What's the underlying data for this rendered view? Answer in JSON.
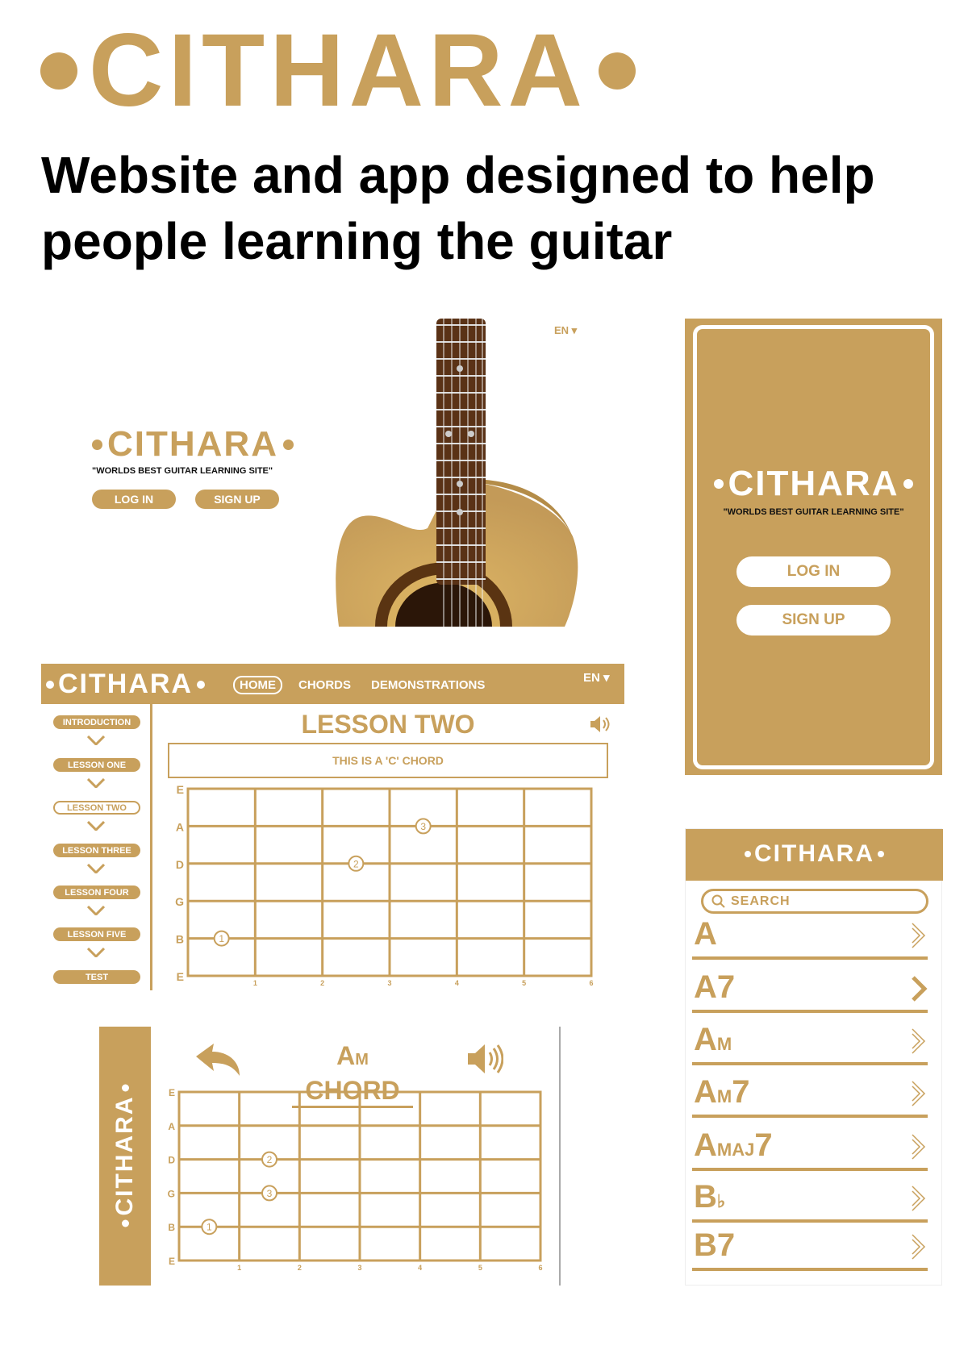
{
  "brand": "CITHARA",
  "headline": "Website and app designed to help people learning the guitar",
  "colors": {
    "gold": "#C8A05C",
    "dark": "#4a2a12"
  },
  "hero": {
    "tagline": "\"WORLDS BEST GUITAR LEARNING SITE\"",
    "login": "LOG IN",
    "signup": "SIGN UP",
    "lang": "EN"
  },
  "phone_login": {
    "tagline": "\"WORLDS BEST GUITAR LEARNING SITE\"",
    "login": "LOG IN",
    "signup": "SIGN UP"
  },
  "lesson": {
    "nav": {
      "home": "HOME",
      "chords": "CHORDS",
      "demos": "DEMONSTRATIONS",
      "lang": "EN"
    },
    "sidebar": [
      "INTRODUCTION",
      "LESSON ONE",
      "LESSON TWO",
      "LESSON THREE",
      "LESSON FOUR",
      "LESSON FIVE",
      "TEST"
    ],
    "active_index": 2,
    "title": "LESSON TWO",
    "caption": "THIS IS A 'C' CHORD"
  },
  "chord_view": {
    "title_main": "A",
    "title_sub": "M",
    "title_rest": " CHORD"
  },
  "chord_data": [
    {
      "type": "fretboard",
      "strings": [
        "E",
        "A",
        "D",
        "G",
        "B",
        "E"
      ],
      "frets": [
        "1",
        "2",
        "3",
        "4",
        "5",
        "6"
      ],
      "fingers": [
        {
          "label": "3",
          "string": 1,
          "cell": 4
        },
        {
          "label": "2",
          "string": 2,
          "cell": 3
        },
        {
          "label": "1",
          "string": 4,
          "cell": 1
        }
      ]
    },
    {
      "type": "fretboard",
      "strings": [
        "E",
        "A",
        "D",
        "G",
        "B",
        "E"
      ],
      "frets": [
        "1",
        "2",
        "3",
        "4",
        "5",
        "6"
      ],
      "fingers": [
        {
          "label": "2",
          "string": 2,
          "cell": 2
        },
        {
          "label": "3",
          "string": 3,
          "cell": 2
        },
        {
          "label": "1",
          "string": 4,
          "cell": 1
        }
      ]
    }
  ],
  "chord_list": {
    "search_placeholder": "SEARCH",
    "items": [
      {
        "main": "A",
        "sub": "",
        "tail": ""
      },
      {
        "main": "A7",
        "sub": "",
        "tail": ""
      },
      {
        "main": "A",
        "sub": "M",
        "tail": ""
      },
      {
        "main": "A",
        "sub": "M",
        "tail": "7"
      },
      {
        "main": "A",
        "sub": "MAJ",
        "tail": "7"
      },
      {
        "main": "B",
        "sub": "♭",
        "tail": ""
      },
      {
        "main": "B7",
        "sub": "",
        "tail": ""
      }
    ]
  }
}
